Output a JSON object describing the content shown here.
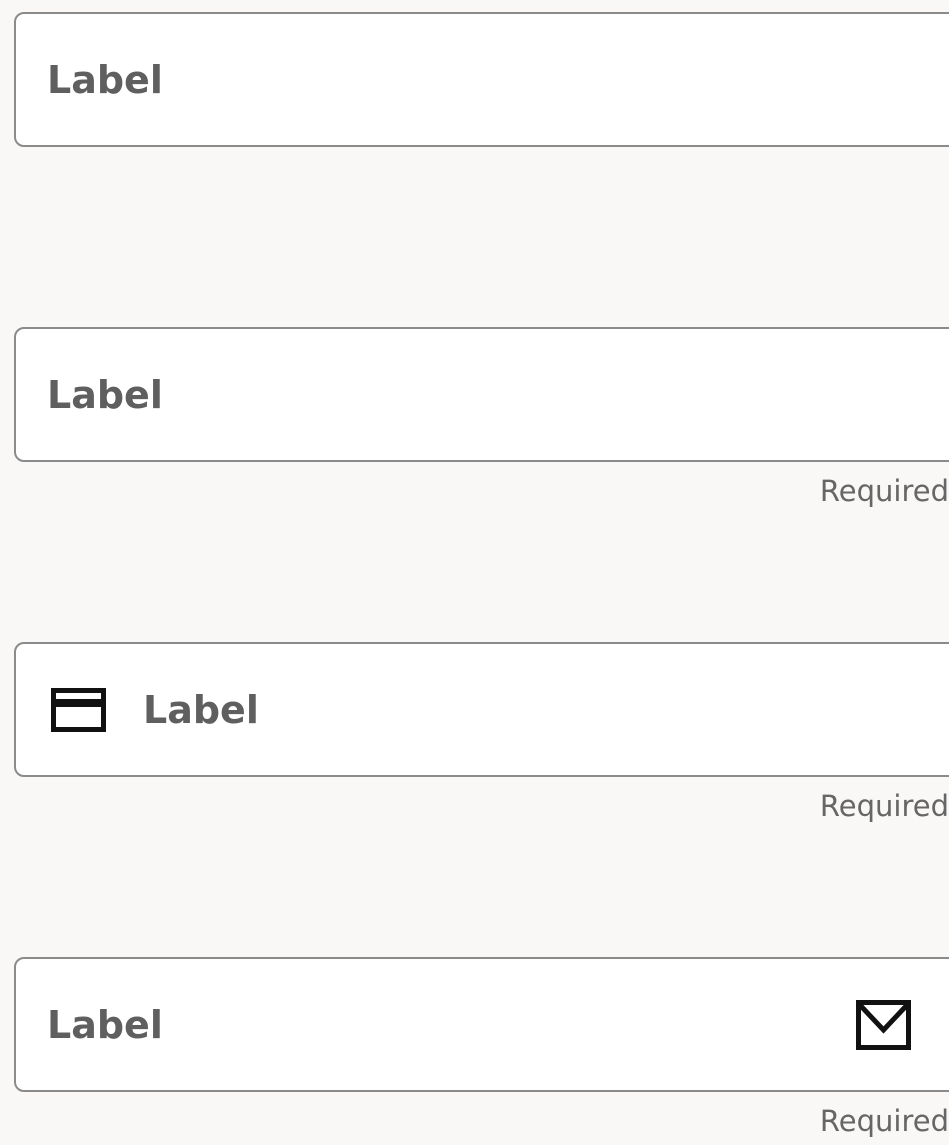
{
  "fields": [
    {
      "label": "Label",
      "helper": ""
    },
    {
      "label": "Label",
      "helper": "Required"
    },
    {
      "label": "Label",
      "helper": "Required",
      "leading_icon": "credit-card-icon"
    },
    {
      "label": "Label",
      "helper": "Required",
      "trailing_icon": "envelope-icon"
    }
  ],
  "colors": {
    "background": "#f9f8f6",
    "field_fill": "#ffffff",
    "field_border": "#8b8b8b",
    "label_text": "#5f5f5f",
    "helper_text": "#666666",
    "icon": "#111111"
  }
}
